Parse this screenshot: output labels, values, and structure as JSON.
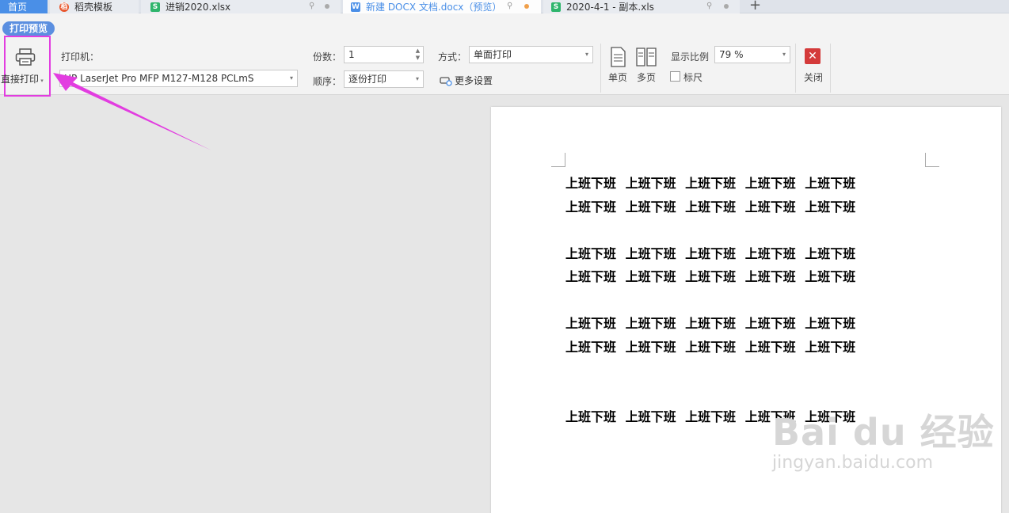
{
  "tabs": [
    {
      "label": "首页"
    },
    {
      "label": "稻壳模板"
    },
    {
      "label": "进销2020.xlsx"
    },
    {
      "label": "新建 DOCX 文档.docx（预览）"
    },
    {
      "label": "2020-4-1 - 副本.xls"
    }
  ],
  "ribbon": {
    "title": "打印预览",
    "direct_print": "直接打印",
    "printer_label": "打印机：",
    "printer_value": "HP LaserJet Pro MFP M127-M128 PCLmS",
    "copies_label": "份数：",
    "copies_value": "1",
    "mode_label": "方式：",
    "mode_value": "单面打印",
    "order_label": "顺序：",
    "order_value": "逐份打印",
    "more_settings": "更多设置",
    "single_page": "单页",
    "multi_page": "多页",
    "zoom_label": "显示比例",
    "zoom_value": "79 %",
    "ruler_label": "标尺",
    "close_label": "关闭"
  },
  "document": {
    "lines": [
      "上班下班 上班下班 上班下班 上班下班 上班下班",
      "上班下班 上班下班 上班下班 上班下班 上班下班",
      "上班下班 上班下班 上班下班 上班下班 上班下班",
      "上班下班 上班下班 上班下班 上班下班 上班下班",
      "上班下班 上班下班 上班下班 上班下班 上班下班",
      "上班下班 上班下班 上班下班 上班下班 上班下班",
      "上班下班 上班下班 上班下班 上班下班 上班下班"
    ]
  },
  "watermark": {
    "brand": "Bai du 经验",
    "url": "jingyan.baidu.com"
  },
  "colors": {
    "accent": "#4a8fe7",
    "highlight": "#e23de0",
    "close": "#d43a3a"
  }
}
